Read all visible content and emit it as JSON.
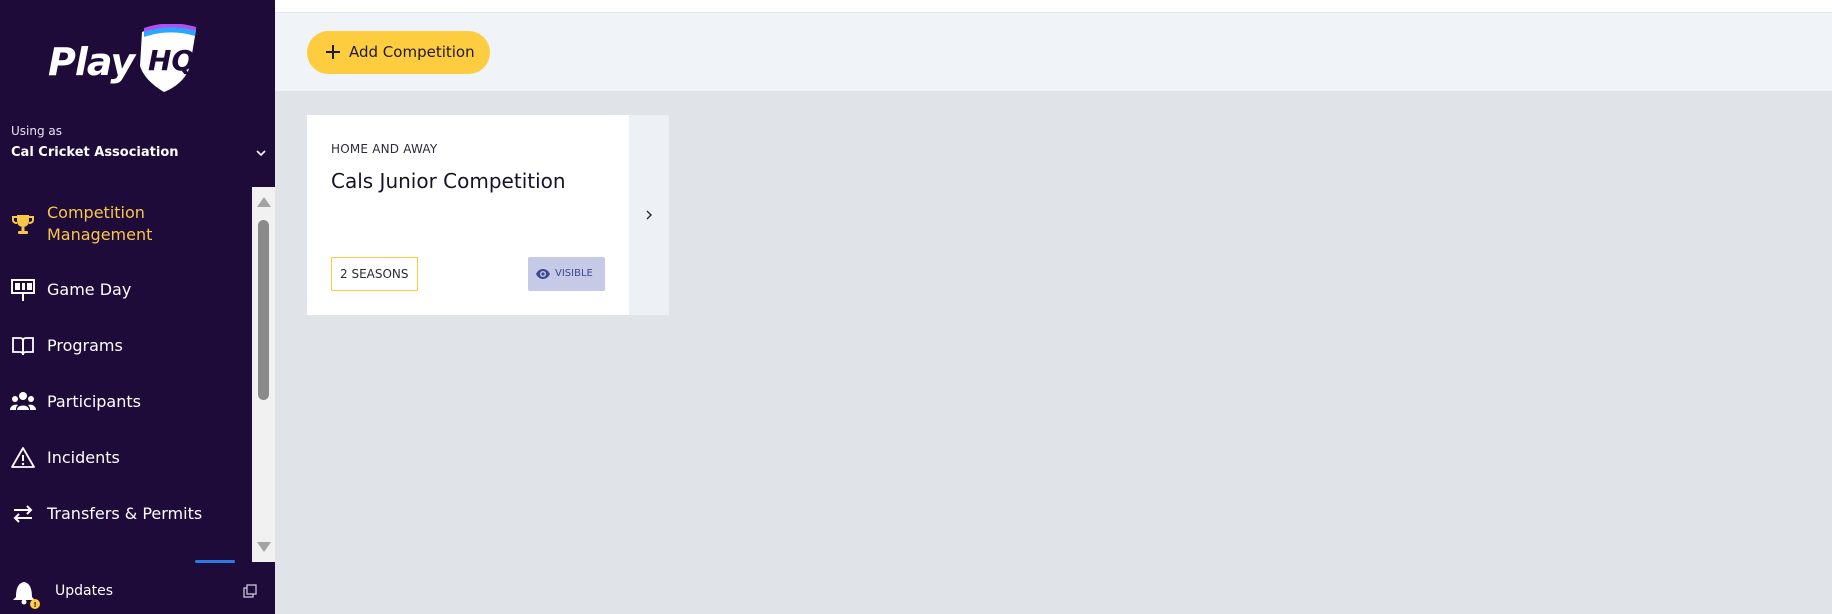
{
  "brand": {
    "logo_text": "Play",
    "logo_mark": "HQ"
  },
  "account": {
    "using_as_label": "Using as",
    "organisation": "Cal Cricket Association"
  },
  "sidebar": {
    "items": [
      {
        "label": "Competition Management",
        "icon": "trophy-icon",
        "active": true
      },
      {
        "label": "Game Day",
        "icon": "scoreboard-icon",
        "active": false
      },
      {
        "label": "Programs",
        "icon": "book-icon",
        "active": false
      },
      {
        "label": "Participants",
        "icon": "people-icon",
        "active": false
      },
      {
        "label": "Incidents",
        "icon": "warning-icon",
        "active": false
      },
      {
        "label": "Transfers & Permits",
        "icon": "transfer-icon",
        "active": false
      }
    ],
    "updates_label": "Updates"
  },
  "toolbar": {
    "add_label": "Add Competition"
  },
  "competitions": [
    {
      "type": "HOME AND AWAY",
      "name": "Cals Junior Competition",
      "seasons": "2 SEASONS",
      "status": "VISIBLE"
    }
  ],
  "colors": {
    "sidebar_bg": "#1e0b3a",
    "accent": "#fecc3f",
    "active_nav": "#f7c748",
    "visible_badge": "#c6cae6"
  }
}
